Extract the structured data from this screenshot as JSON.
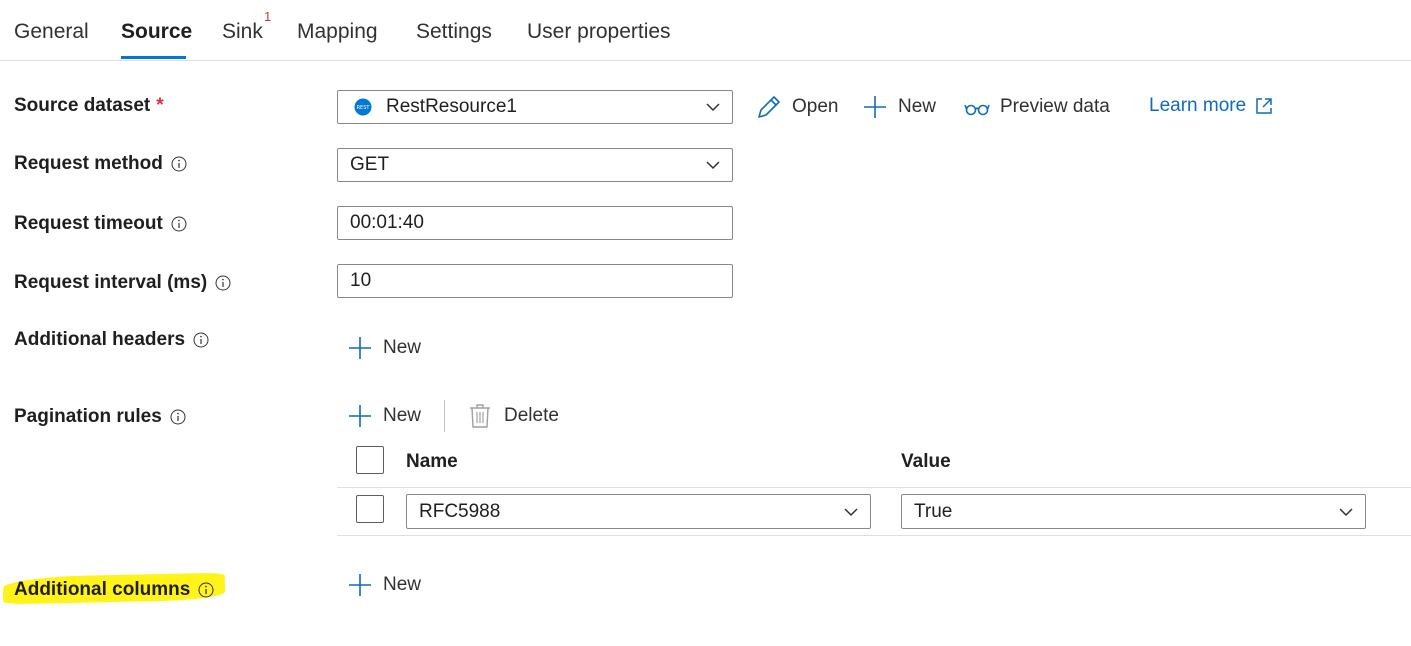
{
  "tabs": [
    {
      "label": "General"
    },
    {
      "label": "Source"
    },
    {
      "label": "Sink",
      "badge": "1"
    },
    {
      "label": "Mapping"
    },
    {
      "label": "Settings"
    },
    {
      "label": "User properties"
    }
  ],
  "source_dataset": {
    "label": "Source dataset",
    "required_mark": "*",
    "value": "RestResource1",
    "dataset_icon_text": "REST",
    "actions": {
      "open": "Open",
      "new": "New",
      "preview": "Preview data",
      "learn_more": "Learn more"
    }
  },
  "request_method": {
    "label": "Request method",
    "value": "GET"
  },
  "request_timeout": {
    "label": "Request timeout",
    "value": "00:01:40"
  },
  "request_interval": {
    "label": "Request interval (ms)",
    "value": "10"
  },
  "additional_headers": {
    "label": "Additional headers",
    "new_label": "New"
  },
  "pagination_rules": {
    "label": "Pagination rules",
    "new_label": "New",
    "delete_label": "Delete",
    "columns": {
      "name": "Name",
      "value": "Value"
    },
    "rows": [
      {
        "name": "RFC5988",
        "value": "True"
      }
    ]
  },
  "additional_columns": {
    "label": "Additional columns",
    "new_label": "New"
  },
  "colors": {
    "accent": "#0078d4",
    "link": "#0f6cbd",
    "required": "#d13438",
    "highlight": "#fff200"
  }
}
